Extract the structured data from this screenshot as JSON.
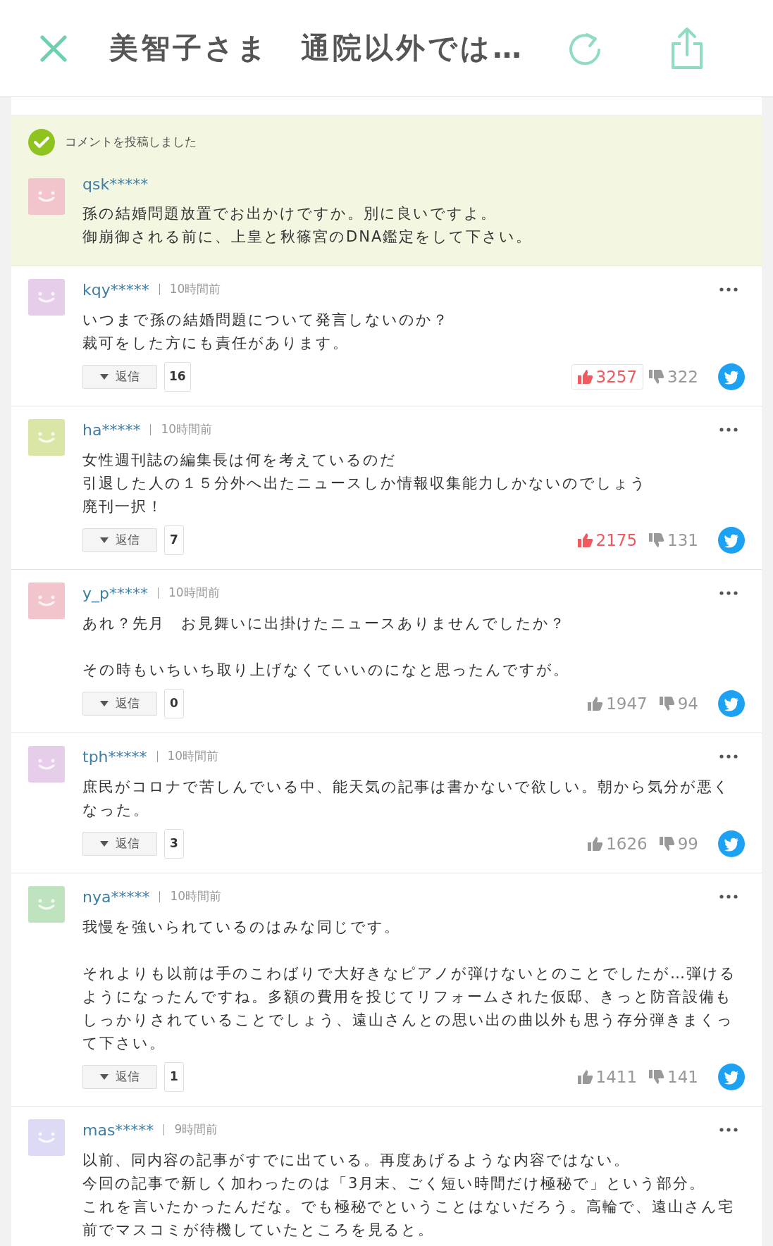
{
  "header": {
    "title": "美智子さま　通院以外では…"
  },
  "posted": {
    "message": "コメントを投稿しました",
    "user": "qsk*****",
    "color": "#f2c4cc",
    "paragraphs": [
      [
        "孫の結婚問題放置でお出かけですか。別に良いですよ。",
        "御崩御される前に、上皇と秋篠宮のDNA鑑定をして下さい。"
      ]
    ]
  },
  "comments": [
    {
      "user": "kqy*****",
      "time": "10時間前",
      "color": "#e6cdea",
      "paragraphs": [
        [
          "いつまで孫の結婚問題について発言しないのか？",
          "裁可をした方にも責任があります。"
        ]
      ],
      "reply_label": "返信",
      "reply_count": "16",
      "likes": "3257",
      "dislikes": "322",
      "popular": true,
      "pressed": true
    },
    {
      "user": "ha*****",
      "time": "10時間前",
      "color": "#d9e6a6",
      "paragraphs": [
        [
          "女性週刊誌の編集長は何を考えているのだ",
          "引退した人の１５分外へ出たニュースしか情報収集能力しかないのでしょう",
          "廃刊一択！"
        ]
      ],
      "reply_label": "返信",
      "reply_count": "7",
      "likes": "2175",
      "dislikes": "131",
      "popular": true,
      "pressed": false
    },
    {
      "user": "y_p*****",
      "time": "10時間前",
      "color": "#f2c4cc",
      "paragraphs": [
        [
          "あれ？先月　お見舞いに出掛けたニュースありませんでしたか？"
        ],
        [
          "その時もいちいち取り上げなくていいのになと思ったんですが。"
        ]
      ],
      "reply_label": "返信",
      "reply_count": "0",
      "likes": "1947",
      "dislikes": "94",
      "popular": false,
      "pressed": false
    },
    {
      "user": "tph*****",
      "time": "10時間前",
      "color": "#e6cdea",
      "paragraphs": [
        [
          "庶民がコロナで苦しんでいる中、能天気の記事は書かないで欲しい。朝から気分が悪くなった。"
        ]
      ],
      "reply_label": "返信",
      "reply_count": "3",
      "likes": "1626",
      "dislikes": "99",
      "popular": false,
      "pressed": false
    },
    {
      "user": "nya*****",
      "time": "10時間前",
      "color": "#bfe3bf",
      "paragraphs": [
        [
          "我慢を強いられているのはみな同じです。"
        ],
        [
          "それよりも以前は手のこわばりで大好きなピアノが弾けないとのことでしたが…弾けるようになったんですね。多額の費用を投じてリフォームされた仮邸、きっと防音設備もしっかりされていることでしょう、遠山さんとの思い出の曲以外も思う存分弾きまくって下さい。"
        ]
      ],
      "reply_label": "返信",
      "reply_count": "1",
      "likes": "1411",
      "dislikes": "141",
      "popular": false,
      "pressed": false
    },
    {
      "user": "mas*****",
      "time": "9時間前",
      "color": "#dcdaf5",
      "paragraphs": [
        [
          "以前、同内容の記事がすでに出ている。再度あげるような内容ではない。",
          "今回の記事で新しく加わったのは「3月末、ごく短い時間だけ極秘で」という部分。",
          "これを言いたかったんだな。でも極秘でということはないだろう。高輪で、遠山さん宅前でマスコミが待機していたところを見ると。"
        ]
      ]
    }
  ]
}
